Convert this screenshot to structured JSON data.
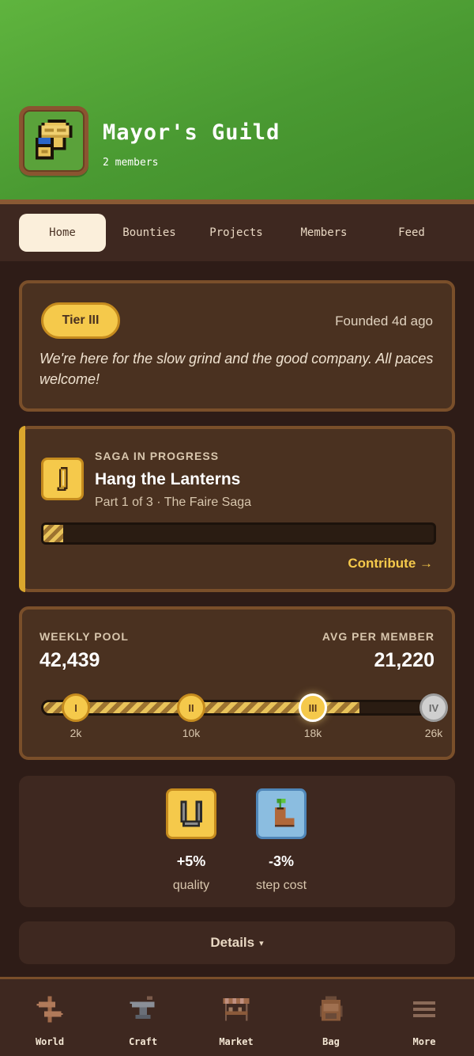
{
  "header": {
    "guild_name": "Mayor's Guild",
    "member_count": "2 members",
    "accent": "#4a9a32"
  },
  "tabs": [
    {
      "label": "Home",
      "active": true
    },
    {
      "label": "Bounties",
      "active": false
    },
    {
      "label": "Projects",
      "active": false
    },
    {
      "label": "Members",
      "active": false
    },
    {
      "label": "Feed",
      "active": false
    }
  ],
  "about": {
    "tier": "Tier III",
    "founded": "Founded 4d ago",
    "motto": "We're here for the slow grind and the good company. All paces welcome!"
  },
  "saga": {
    "kicker": "SAGA IN PROGRESS",
    "title": "Hang the Lanterns",
    "subtitle": "Part 1 of 3 · The Faire Saga",
    "progress": 0.05,
    "action": "Contribute →",
    "icon": "lantern-scroll-icon"
  },
  "pool": {
    "left_label": "WEEKLY POOL",
    "left_value": "42,439",
    "right_label": "AVG PER MEMBER",
    "right_value": "21,220",
    "progress_value": 42439,
    "max_value": 26000,
    "milestones": [
      {
        "roman": "I",
        "label": "2k",
        "state": "done"
      },
      {
        "roman": "II",
        "label": "10k",
        "state": "done"
      },
      {
        "roman": "III",
        "label": "18k",
        "state": "current"
      },
      {
        "roman": "IV",
        "label": "26k",
        "state": "future"
      }
    ]
  },
  "perks": [
    {
      "value": "+5%",
      "label": "quality",
      "icon": "horseshoe-icon"
    },
    {
      "value": "-3%",
      "label": "step cost",
      "icon": "sprout-boot-icon"
    }
  ],
  "details": {
    "label": "Details",
    "arrow": "▾"
  },
  "bottom_nav": [
    {
      "label": "World",
      "icon": "signpost-icon"
    },
    {
      "label": "Craft",
      "icon": "anvil-icon"
    },
    {
      "label": "Market",
      "icon": "market-stall-icon"
    },
    {
      "label": "Bag",
      "icon": "backpack-icon"
    },
    {
      "label": "More",
      "icon": "menu-icon"
    }
  ]
}
